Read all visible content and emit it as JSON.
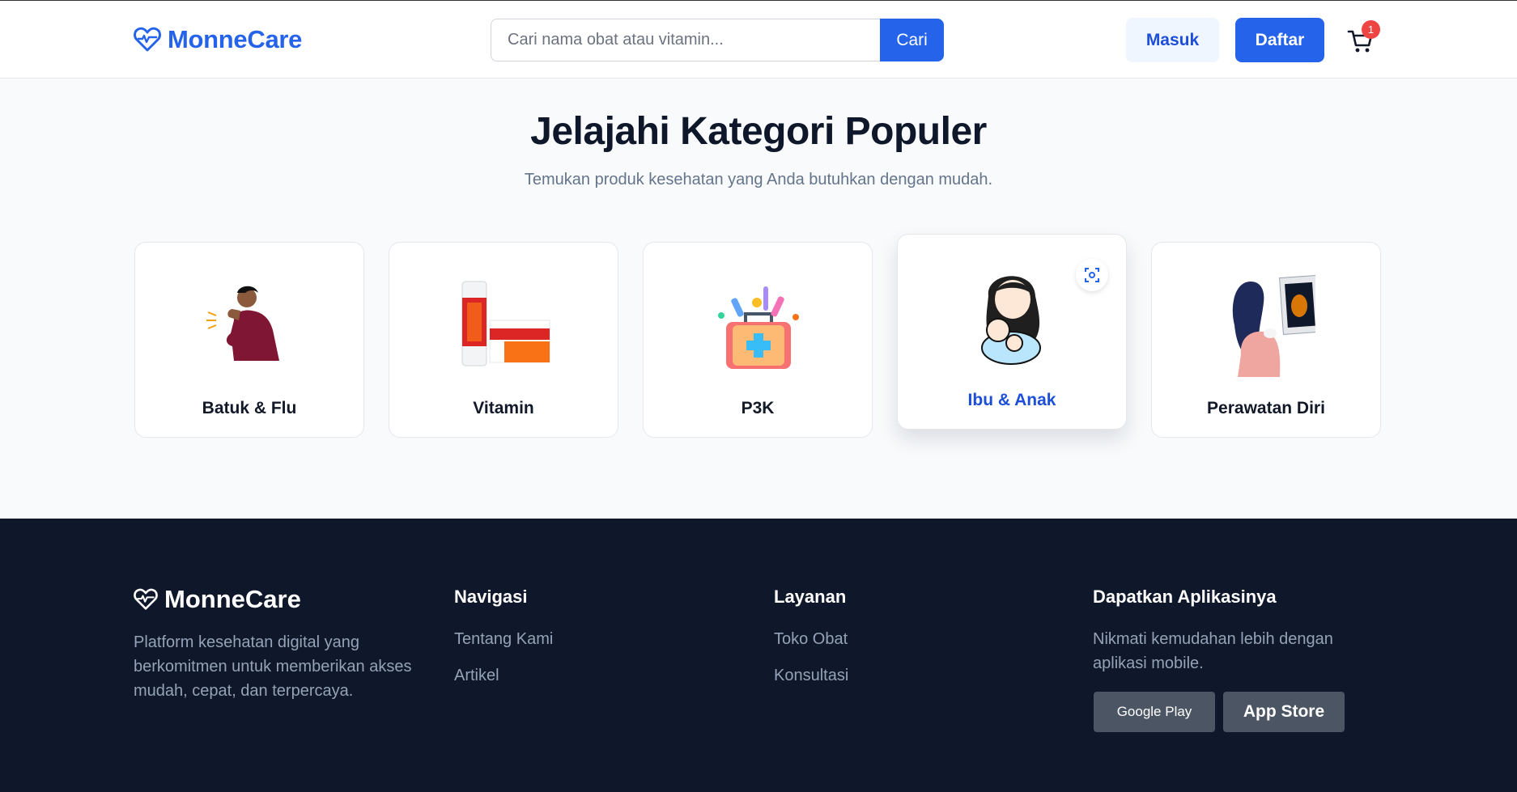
{
  "header": {
    "brand": "MonneCare",
    "search_placeholder": "Cari nama obat atau vitamin...",
    "search_button": "Cari",
    "login": "Masuk",
    "register": "Daftar",
    "cart_count": "1"
  },
  "section": {
    "title": "Jelajahi Kategori Populer",
    "subtitle": "Temukan produk kesehatan yang Anda butuhkan dengan mudah."
  },
  "categories": [
    {
      "label": "Batuk & Flu",
      "icon": "coughing-person-illustration"
    },
    {
      "label": "Vitamin",
      "icon": "vitamin-product-illustration"
    },
    {
      "label": "P3K",
      "icon": "first-aid-kit-illustration"
    },
    {
      "label": "Ibu & Anak",
      "icon": "mother-and-baby-illustration",
      "active": true
    },
    {
      "label": "Perawatan Diri",
      "icon": "self-care-woman-illustration"
    }
  ],
  "footer": {
    "brand": "MonneCare",
    "description": "Platform kesehatan digital yang berkomitmen untuk memberikan akses mudah, cepat, dan terpercaya.",
    "nav_title": "Navigasi",
    "nav_links": [
      "Tentang Kami",
      "Artikel"
    ],
    "services_title": "Layanan",
    "services_links": [
      "Toko Obat",
      "Konsultasi"
    ],
    "app_title": "Dapatkan Aplikasinya",
    "app_description": "Nikmati kemudahan lebih dengan aplikasi mobile.",
    "google_play": "Google Play",
    "app_store": "App Store"
  },
  "colors": {
    "primary": "#2563eb",
    "footer_bg": "#0f172a",
    "badge": "#ef4444"
  }
}
